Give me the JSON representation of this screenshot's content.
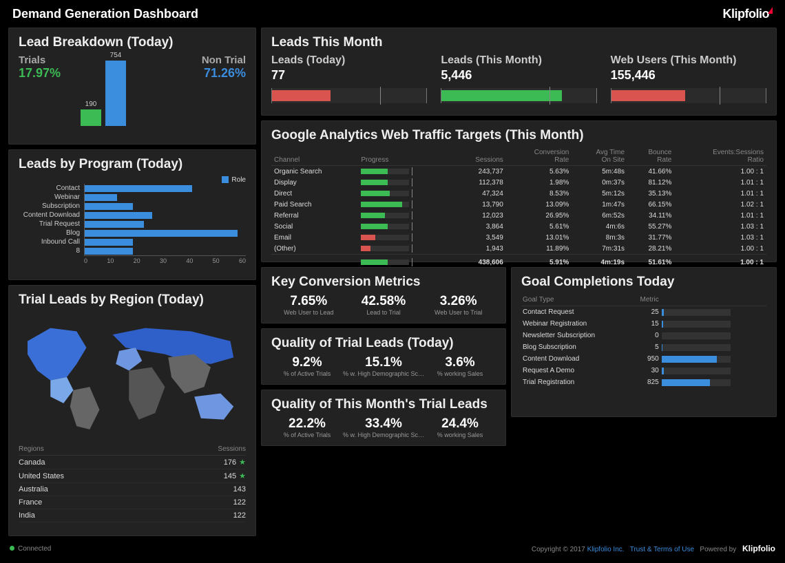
{
  "header": {
    "title": "Demand Generation Dashboard",
    "brand": "Klipfolio"
  },
  "lead_breakdown": {
    "title": "Lead Breakdown (Today)",
    "trials_label": "Trials",
    "trials_pct": "17.97%",
    "non_trial_label": "Non Trial",
    "non_trial_pct": "71.26%",
    "bars": [
      {
        "label": "190",
        "value": 190,
        "color": "green"
      },
      {
        "label": "754",
        "value": 754,
        "color": "blue"
      }
    ]
  },
  "chart_data": [
    {
      "type": "bar",
      "id": "lead_breakdown_bars",
      "categories": [
        "Trials",
        "Non Trial"
      ],
      "values": [
        190,
        754
      ],
      "title": "Lead Breakdown (Today)"
    },
    {
      "type": "bar",
      "id": "leads_by_program",
      "orientation": "horizontal",
      "title": "Leads by Program (Today)",
      "legend": [
        "Role"
      ],
      "categories": [
        "Contact",
        "Webinar",
        "Subscription",
        "Content Download",
        "Trial Request",
        "Blog",
        "Inbound Call",
        "8"
      ],
      "values": [
        40,
        12,
        18,
        25,
        22,
        57,
        18,
        18
      ],
      "xlim": [
        0,
        60
      ],
      "xticks": [
        0,
        10,
        20,
        30,
        40,
        50,
        60
      ]
    },
    {
      "type": "map",
      "id": "trial_leads_region_map",
      "title": "Trial Leads by Region (Today)",
      "highlighted": [
        "Canada",
        "United States",
        "Australia",
        "France",
        "India",
        "Russia",
        "Brazil",
        "United Kingdom",
        "China"
      ]
    },
    {
      "type": "table",
      "id": "ga_targets",
      "title": "Google Analytics Web Traffic Targets (This Month)",
      "columns": [
        "Channel",
        "Progress",
        "Sessions",
        "Conversion Rate",
        "Avg Time On Site",
        "Bounce Rate",
        "Events:Sessions Ratio"
      ],
      "rows": [
        [
          "Organic Search",
          "green:0.55",
          243737,
          "5.63%",
          "5m:48s",
          "41.66%",
          "1.00 : 1"
        ],
        [
          "Display",
          "green:0.55",
          112378,
          "1.98%",
          "0m:37s",
          "81.12%",
          "1.01 : 1"
        ],
        [
          "Direct",
          "green:0.60",
          47324,
          "8.53%",
          "5m:12s",
          "35.13%",
          "1.01 : 1"
        ],
        [
          "Paid Search",
          "green:0.85",
          13790,
          "13.09%",
          "1m:47s",
          "66.15%",
          "1.02 : 1"
        ],
        [
          "Referral",
          "green:0.50",
          12023,
          "26.95%",
          "6m:52s",
          "34.11%",
          "1.01 : 1"
        ],
        [
          "Social",
          "green:0.55",
          3864,
          "5.61%",
          "4m:6s",
          "55.27%",
          "1.03 : 1"
        ],
        [
          "Email",
          "red:0.30",
          3549,
          "13.01%",
          "8m:3s",
          "31.77%",
          "1.03 : 1"
        ],
        [
          "(Other)",
          "red:0.20",
          1943,
          "11.89%",
          "7m:31s",
          "28.21%",
          "1.00 : 1"
        ]
      ],
      "totals": [
        "",
        "green:0.55",
        "438,606",
        "5.91%",
        "4m:19s",
        "51.61%",
        "1.00 : 1"
      ]
    },
    {
      "type": "bar",
      "id": "goal_completions",
      "orientation": "horizontal",
      "title": "Goal Completions Today",
      "categories": [
        "Contact Request",
        "Webinar Registration",
        "Newsletter Subscription",
        "Blog Subscription",
        "Content Download",
        "Request A Demo",
        "Trial Registration"
      ],
      "values": [
        25,
        15,
        0,
        5,
        950,
        30,
        825
      ]
    }
  ],
  "leads_by_program": {
    "title": "Leads by Program (Today)",
    "legend": "Role",
    "rows": [
      {
        "label": "Contact",
        "value": 40
      },
      {
        "label": "Webinar",
        "value": 12
      },
      {
        "label": "Subscription",
        "value": 18
      },
      {
        "label": "Content Download",
        "value": 25
      },
      {
        "label": "Trial Request",
        "value": 22
      },
      {
        "label": "Blog",
        "value": 57
      },
      {
        "label": "Inbound Call",
        "value": 18
      },
      {
        "label": "8",
        "value": 18
      }
    ],
    "axis": [
      "0",
      "10",
      "20",
      "30",
      "40",
      "50",
      "60"
    ]
  },
  "region": {
    "title": "Trial Leads by Region (Today)",
    "columns": [
      "Regions",
      "Sessions"
    ],
    "rows": [
      {
        "r": "Canada",
        "s": "176",
        "star": true
      },
      {
        "r": "United States",
        "s": "145",
        "star": true
      },
      {
        "r": "Australia",
        "s": "143",
        "star": false
      },
      {
        "r": "France",
        "s": "122",
        "star": false
      },
      {
        "r": "India",
        "s": "122",
        "star": false
      }
    ]
  },
  "leads_month": {
    "title": "Leads This Month",
    "cols": [
      {
        "label": "Leads (Today)",
        "value": "77",
        "fill": 0.38,
        "color": "red",
        "tick": 0.7
      },
      {
        "label": "Leads (This Month)",
        "value": "5,446",
        "fill": 0.78,
        "color": "green",
        "tick": 0.7
      },
      {
        "label": "Web Users (This Month)",
        "value": "155,446",
        "fill": 0.48,
        "color": "red",
        "tick": 0.7
      }
    ]
  },
  "ga": {
    "title": "Google Analytics Web Traffic Targets (This Month)",
    "cols": [
      "Channel",
      "Progress",
      "Sessions",
      "Conversion\nRate",
      "Avg Time\nOn Site",
      "Bounce\nRate",
      "Events:Sessions\nRatio"
    ],
    "rows": [
      {
        "c": "Organic Search",
        "p": 0.55,
        "pc": "g",
        "s": "243,737",
        "cr": "5.63%",
        "t": "5m:48s",
        "b": "41.66%",
        "e": "1.00 : 1"
      },
      {
        "c": "Display",
        "p": 0.55,
        "pc": "g",
        "s": "112,378",
        "cr": "1.98%",
        "t": "0m:37s",
        "b": "81.12%",
        "e": "1.01 : 1"
      },
      {
        "c": "Direct",
        "p": 0.6,
        "pc": "g",
        "s": "47,324",
        "cr": "8.53%",
        "t": "5m:12s",
        "b": "35.13%",
        "e": "1.01 : 1"
      },
      {
        "c": "Paid Search",
        "p": 0.85,
        "pc": "g",
        "s": "13,790",
        "cr": "13.09%",
        "t": "1m:47s",
        "b": "66.15%",
        "e": "1.02 : 1"
      },
      {
        "c": "Referral",
        "p": 0.5,
        "pc": "g",
        "s": "12,023",
        "cr": "26.95%",
        "t": "6m:52s",
        "b": "34.11%",
        "e": "1.01 : 1"
      },
      {
        "c": "Social",
        "p": 0.55,
        "pc": "g",
        "s": "3,864",
        "cr": "5.61%",
        "t": "4m:6s",
        "b": "55.27%",
        "e": "1.03 : 1"
      },
      {
        "c": "Email",
        "p": 0.3,
        "pc": "r",
        "s": "3,549",
        "cr": "13.01%",
        "t": "8m:3s",
        "b": "31.77%",
        "e": "1.03 : 1"
      },
      {
        "c": "(Other)",
        "p": 0.2,
        "pc": "r",
        "s": "1,943",
        "cr": "11.89%",
        "t": "7m:31s",
        "b": "28.21%",
        "e": "1.00 : 1"
      }
    ],
    "total": {
      "p": 0.55,
      "pc": "g",
      "s": "438,606",
      "cr": "5.91%",
      "t": "4m:19s",
      "b": "51.61%",
      "e": "1.00 : 1"
    }
  },
  "kcm": {
    "title": "Key Conversion Metrics",
    "items": [
      {
        "n": "7.65%",
        "l": "Web User to Lead"
      },
      {
        "n": "42.58%",
        "l": "Lead to Trial"
      },
      {
        "n": "3.26%",
        "l": "Web User to Trial"
      }
    ]
  },
  "qtoday": {
    "title": "Quality of Trial Leads (Today)",
    "items": [
      {
        "n": "9.2%",
        "l": "% of Active Trials"
      },
      {
        "n": "15.1%",
        "l": "% w. High Demographic Sc…"
      },
      {
        "n": "3.6%",
        "l": "% working Sales"
      }
    ]
  },
  "qmonth": {
    "title": "Quality of This Month's Trial Leads",
    "items": [
      {
        "n": "22.2%",
        "l": "% of Active Trials"
      },
      {
        "n": "33.4%",
        "l": "% w. High Demographic Sc…"
      },
      {
        "n": "24.4%",
        "l": "% working Sales"
      }
    ]
  },
  "gc": {
    "title": "Goal Completions Today",
    "cols": [
      "Goal Type",
      "Metric"
    ],
    "rows": [
      {
        "g": "Contact Request",
        "m": "25",
        "p": 0.03
      },
      {
        "g": "Webinar Registration",
        "m": "15",
        "p": 0.02
      },
      {
        "g": "Newsletter Subscription",
        "m": "0",
        "p": 0.0
      },
      {
        "g": "Blog Subscription",
        "m": "5",
        "p": 0.01
      },
      {
        "g": "Content Download",
        "m": "950",
        "p": 0.8
      },
      {
        "g": "Request A Demo",
        "m": "30",
        "p": 0.03
      },
      {
        "g": "Trial Registration",
        "m": "825",
        "p": 0.7
      }
    ]
  },
  "footer": {
    "status": "Connected",
    "copyright": "Copyright © 2017",
    "link1": "Klipfolio Inc.",
    "link2": "Trust & Terms of Use",
    "powered": "Powered by",
    "brand": "Klipfolio"
  }
}
